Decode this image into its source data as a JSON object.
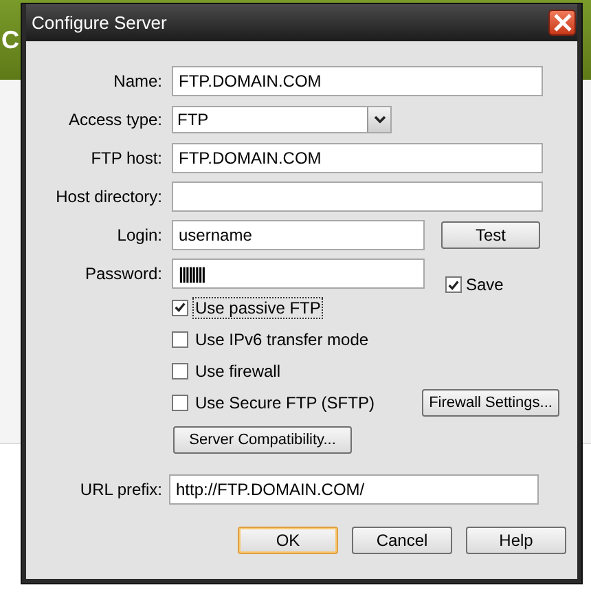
{
  "background": {
    "heading": "C"
  },
  "dialog": {
    "title": "Configure Server",
    "fields": [
      {
        "kind": "text",
        "label": "Name:",
        "value": "FTP.DOMAIN.COM"
      },
      {
        "kind": "select",
        "label": "Access type:",
        "value": "FTP"
      },
      {
        "kind": "text",
        "label": "FTP host:",
        "value": "FTP.DOMAIN.COM"
      },
      {
        "kind": "text",
        "label": "Host directory:"
      }
    ],
    "login": {
      "label": "Login:",
      "value": "username"
    },
    "test_button": "Test",
    "password": {
      "label": "Password:",
      "value": "||||||||"
    },
    "save": {
      "label": "Save",
      "checked": true
    },
    "options": [
      {
        "label": "Use passive FTP",
        "checked": true,
        "focused": true
      },
      {
        "label": "Use IPv6 transfer mode",
        "checked": false,
        "focused": false
      },
      {
        "label": "Use firewall",
        "checked": false,
        "focused": false
      },
      {
        "label": "Use Secure FTP (SFTP)",
        "checked": false,
        "focused": false
      }
    ],
    "firewall_button": "Firewall Settings...",
    "compat_button": "Server Compatibility...",
    "url_prefix": {
      "label": "URL prefix:",
      "value": "http://FTP.DOMAIN.COM/"
    },
    "buttons": [
      {
        "label": "OK",
        "default": true
      },
      {
        "label": "Cancel",
        "default": false
      },
      {
        "label": "Help",
        "default": false
      }
    ]
  }
}
